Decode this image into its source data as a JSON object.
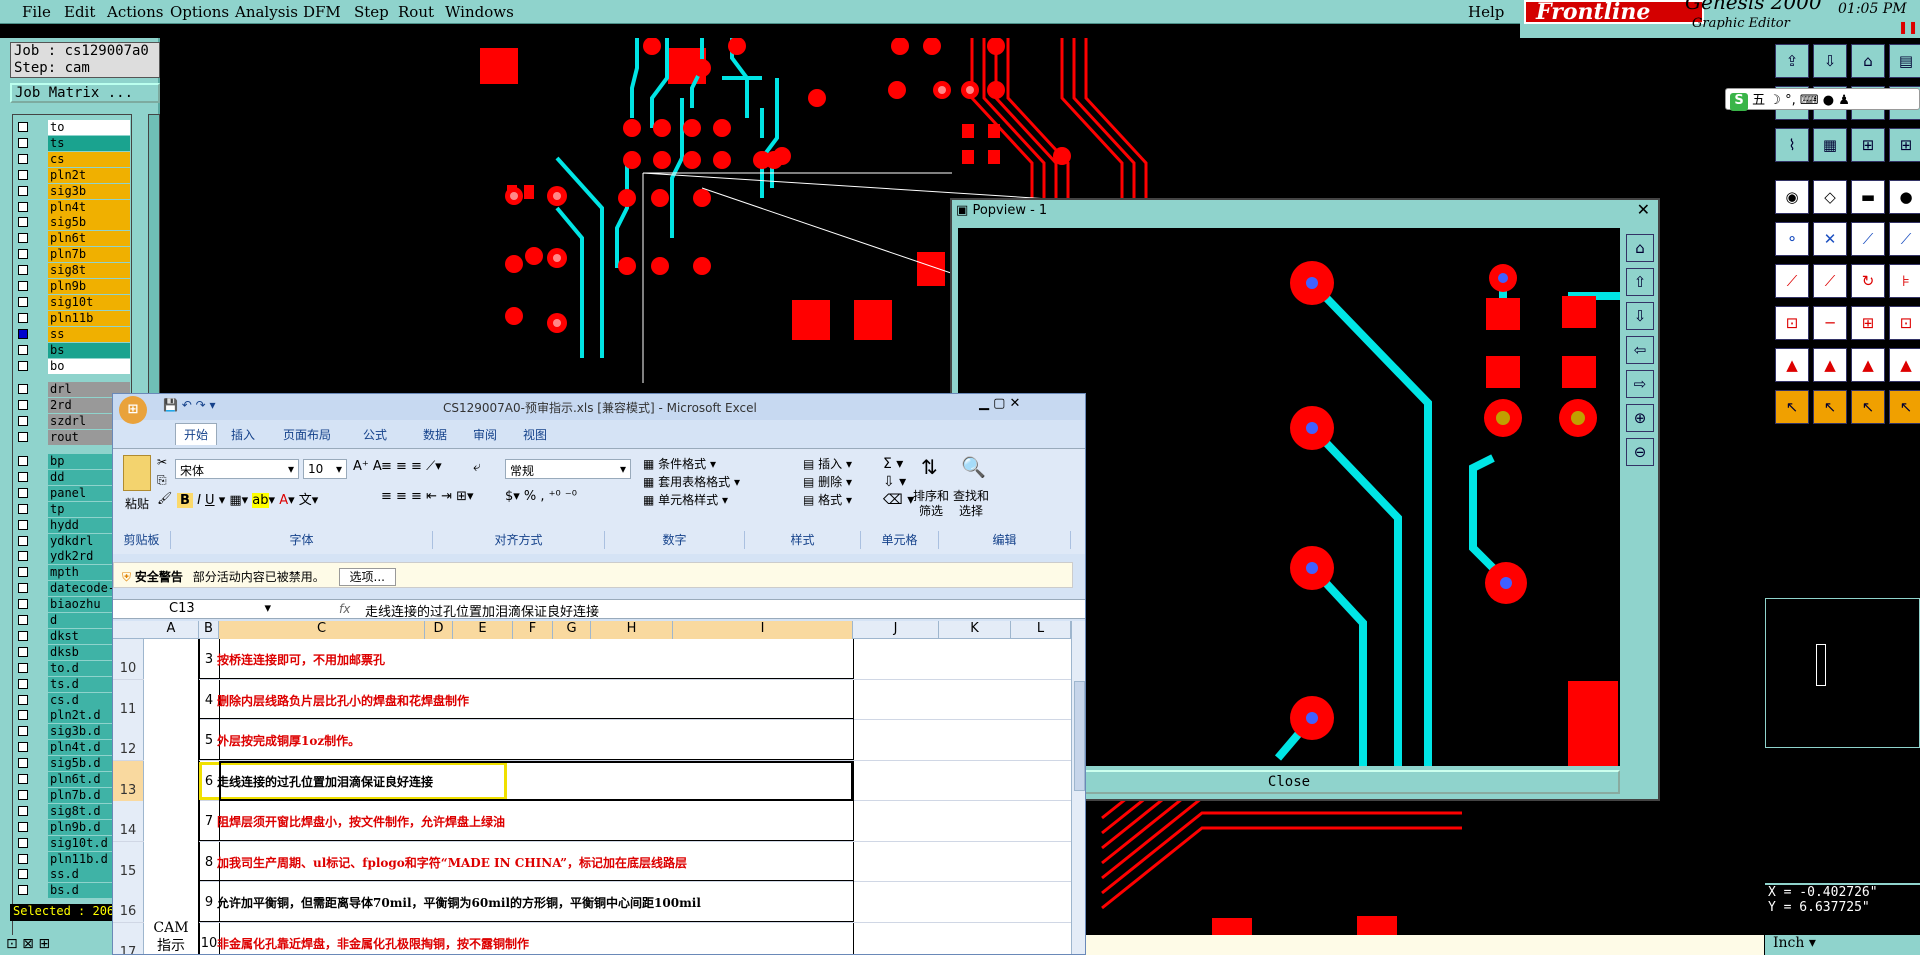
{
  "menu": {
    "file": "File",
    "edit": "Edit",
    "actions": "Actions",
    "options": "Options",
    "analysis": "Analysis",
    "dfm": "DFM",
    "step": "Step",
    "rout": "Rout",
    "windows": "Windows",
    "help": "Help"
  },
  "brand": {
    "frontline": "Frontline",
    "genesis": "Genesis 2000",
    "graphic_editor": "Graphic Editor",
    "clock": "01:05 PM"
  },
  "job": {
    "job_label": "Job : cs129007a0",
    "step_label": "Step: cam",
    "matrix_button": "Job Matrix ..."
  },
  "layers_board": [
    "to",
    "ts",
    "cs",
    "pln2t",
    "sig3b",
    "pln4t",
    "sig5b",
    "pln6t",
    "pln7b",
    "sig8t",
    "pln9b",
    "sig10t",
    "pln11b",
    "ss",
    "bs",
    "bo"
  ],
  "layers_drill": [
    "drl",
    "2rd",
    "szdrl",
    "rout"
  ],
  "layers_misc": [
    "bp",
    "dd",
    "panel",
    "tp",
    "hydd",
    "ydkdrl",
    "ydk2rd",
    "mpth",
    "datecode-",
    "biaozhu",
    "d",
    "dkst",
    "dksb",
    "to.d",
    "ts.d",
    "cs.d",
    "pln2t.d",
    "sig3b.d",
    "pln4t.d",
    "sig5b.d",
    "pln6t.d",
    "pln7b.d",
    "sig8t.d",
    "pln9b.d",
    "sig10t.d",
    "pln11b.d",
    "ss.d",
    "bs.d"
  ],
  "selected_label": "Selected : 206",
  "popview": {
    "title": "Popview - 1",
    "close_label": "Close"
  },
  "coords": {
    "x": "X = -0.402726\"",
    "y": "Y = 6.637725\""
  },
  "units": "Inch",
  "ime": {
    "text": "五"
  },
  "excel": {
    "title": "CS129007A0-预审指示.xls [兼容模式] - Microsoft Excel",
    "tabs": [
      "开始",
      "插入",
      "页面布局",
      "公式",
      "数据",
      "审阅",
      "视图"
    ],
    "font_name": "宋体",
    "font_size": "10",
    "number_format": "常规",
    "groups": [
      "剪贴板",
      "字体",
      "对齐方式",
      "数字",
      "样式",
      "单元格",
      "编辑"
    ],
    "paste_label": "粘贴",
    "style_items": [
      "条件格式",
      "套用表格格式",
      "单元格样式"
    ],
    "cell_items": [
      "插入",
      "删除",
      "格式"
    ],
    "edit_items": [
      "排序和\n筛选",
      "查找和\n选择"
    ],
    "security": {
      "title": "安全警告",
      "message": "部分活动内容已被禁用。",
      "button": "选项..."
    },
    "name_box": "C13",
    "fx": "fx",
    "formula": "走线连接的过孔位置加泪滴保证良好连接",
    "columns": [
      "A",
      "B",
      "C",
      "D",
      "E",
      "F",
      "G",
      "H",
      "I",
      "J",
      "K",
      "L"
    ],
    "section_label": "CAM\n指示",
    "rows": [
      {
        "rn": "10",
        "b": "3",
        "text": "按桥连连接即可，不用加邮票孔",
        "red": true
      },
      {
        "rn": "11",
        "b": "4",
        "text": "删除内层线路负片层比孔小的焊盘和花焊盘制作",
        "red": true
      },
      {
        "rn": "12",
        "b": "5",
        "text": "外层按完成铜厚1oz制作。",
        "red": true
      },
      {
        "rn": "13",
        "b": "6",
        "text": "走线连接的过孔位置加泪滴保证良好连接",
        "red": false
      },
      {
        "rn": "14",
        "b": "7",
        "text": "阻焊层须开窗比焊盘小，按文件制作，允许焊盘上绿油",
        "red": true
      },
      {
        "rn": "15",
        "b": "8",
        "text": "加我司生产周期、ul标记、fplogo和字符“MADE IN CHINA”，标记加在底层线路层",
        "red": true
      },
      {
        "rn": "16",
        "b": "9",
        "text": "允许加平衡铜，但需距离导体70mil，平衡铜为60mil的方形铜，平衡铜中心间距100mil",
        "red": false
      },
      {
        "rn": "17",
        "b": "10",
        "text": "非金属化孔靠近焊盘，非金属化孔极限掏铜，按不露铜制作",
        "red": true
      }
    ]
  },
  "colors": {
    "menu_bg": "#8fd3cc",
    "pad": "#ff0000",
    "trace": "#00e5e5"
  }
}
